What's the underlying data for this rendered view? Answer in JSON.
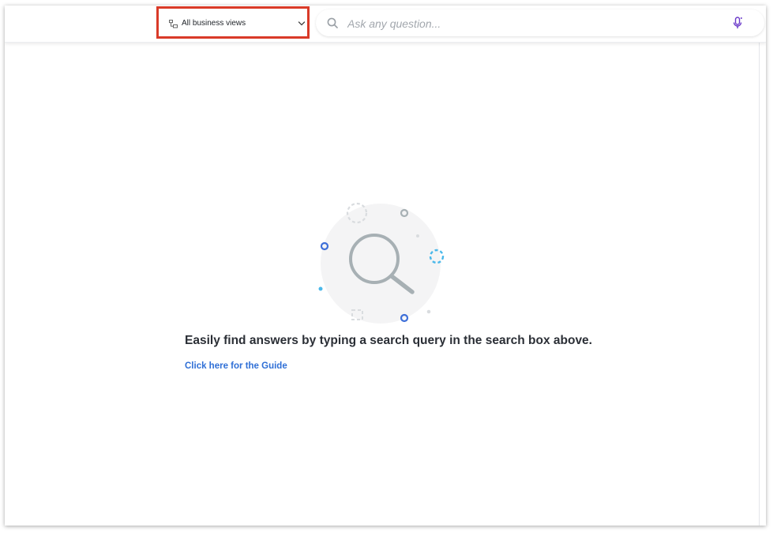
{
  "toolbar": {
    "business_view_selector": {
      "label": "All business views",
      "icon": "business-views-icon",
      "dropdown_icon": "chevron-down-icon"
    },
    "search": {
      "placeholder": "Ask any question...",
      "value": "",
      "icon": "search-icon",
      "voice_icon": "microphone-icon"
    }
  },
  "empty_state": {
    "illustration": "magnifying-glass-illustration",
    "message": "Easily find answers by typing a search query in the search box above.",
    "guide_link": "Click here for the Guide"
  },
  "colors": {
    "highlight": "#d93a28",
    "link": "#2f6fd6",
    "mic": "#6a39c9",
    "illustration_circle": "#f4f4f5",
    "illustration_glass": "#a7b0b4"
  }
}
